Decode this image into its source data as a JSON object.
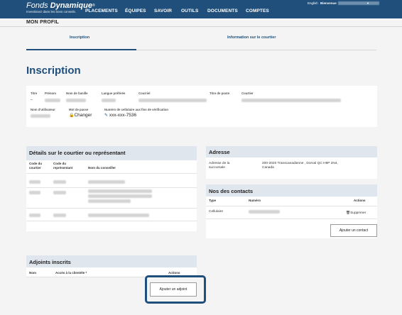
{
  "brand": {
    "name_light": "Fonds ",
    "name_bold": "Dynamique",
    "reg": "®",
    "tagline": "Investissez dans les bons conseils."
  },
  "nav": {
    "items": [
      "PLACEMENTS",
      "ÉQUIPES",
      "SAVOIR",
      "OUTILS",
      "DOCUMENTS",
      "COMPTES"
    ],
    "language_link": "English",
    "welcome_label": "Bienvenue",
    "caret": "▼"
  },
  "page_title": "MON PROFIL",
  "tabs": [
    "Inscription",
    "Information sur le courtier"
  ],
  "section_heading": "Inscription",
  "profile": {
    "labels": {
      "titre": "Titre",
      "prenom": "Prénom",
      "nom_famille": "Nom de famille",
      "langue": "Langue préférée",
      "courriel": "Courriel",
      "titre_poste": "Titre de poste",
      "courtier": "Courtier",
      "nom_utilisateur": "Nom d'utilisateur",
      "mot_de_passe": "Mot de passe",
      "cellulaire": "Numéro de cellulaire aux fins de vérification"
    },
    "titre_value": "–",
    "change_password": "Changer",
    "phone_value": "xxx-xxx-7536"
  },
  "broker_panel": {
    "title": "Détails sur le courtier ou représentant",
    "col_code_courtier": "Code du courtier",
    "col_code_representant": "Code du représentant",
    "col_nom_conseiller": "Nom du conseiller"
  },
  "adresse_panel": {
    "title": "Adresse",
    "label": "Adresse de la succursale",
    "value_line1": "200-2020 Transcanadienne , Dorval QC H9P 2N4,",
    "value_line2": "Canada"
  },
  "contacts_panel": {
    "title": "Nos des contacts",
    "col_type": "Type",
    "col_numero": "Numéro",
    "col_actions": "Actions",
    "row_type": "Cellulaire",
    "delete_label": "Supprimer",
    "add_button": "Ajouter un contact"
  },
  "adjoints_panel": {
    "title": "Adjoints inscrits",
    "col_nom": "Nom",
    "col_acces": "Accès à la clientèle *",
    "col_actions": "Actions",
    "add_button": "Ajouter un adjoint"
  },
  "colors": {
    "brand_blue": "#1f4f7a",
    "panel_header": "#dfe6ee",
    "page_background": "#f4f4f4"
  }
}
